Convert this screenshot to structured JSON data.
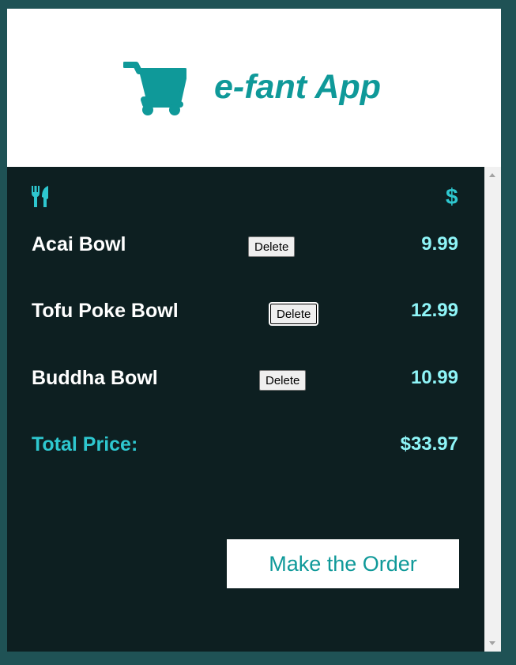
{
  "header": {
    "title": "e-fant App",
    "cart_icon": "shopping-cart-icon",
    "accent_color": "#0f9999"
  },
  "columns": {
    "name_icon": "fork-knife-icon",
    "price_icon": "$"
  },
  "items": [
    {
      "name": "Acai Bowl",
      "delete_label": "Delete",
      "price": "9.99"
    },
    {
      "name": "Tofu Poke Bowl",
      "delete_label": "Delete",
      "price": "12.99"
    },
    {
      "name": "Buddha Bowl",
      "delete_label": "Delete",
      "price": "10.99"
    }
  ],
  "total": {
    "label": "Total Price:",
    "value": "$33.97"
  },
  "order_button": "Make the Order",
  "colors": {
    "page_bg": "#1f5255",
    "panel_bg": "#0d1f21",
    "price_color": "#8ff5f8",
    "label_color": "#2ec7cf"
  }
}
